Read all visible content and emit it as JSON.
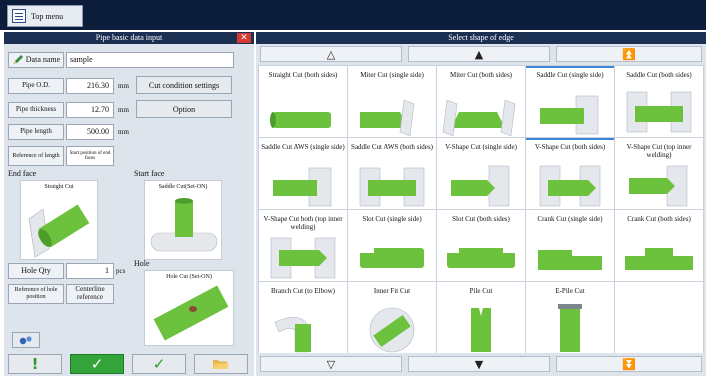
{
  "top_bar": {
    "top_menu_label": "Top menu"
  },
  "left_panel": {
    "title": "Pipe basic data input",
    "close_symbol": "✕",
    "data_name": {
      "label": "Data name",
      "value": "sample"
    },
    "pipe_od": {
      "label": "Pipe O.D.",
      "value": "216.30",
      "unit": "mm"
    },
    "pipe_thickness": {
      "label": "Pipe thickness",
      "value": "12.70",
      "unit": "mm"
    },
    "pipe_length": {
      "label": "Pipe length",
      "value": "500.00",
      "unit": "mm"
    },
    "reference_length": {
      "label": "Reference of length",
      "value": "Start position of end faces"
    },
    "cut_condition_label": "Cut condition settings",
    "option_label": "Option",
    "end_face": {
      "label": "End face",
      "preview_caption": "Straight Cut"
    },
    "start_face": {
      "label": "Start face",
      "preview_caption": "Saddle Cut(Set-ON)"
    },
    "hole_qty": {
      "label": "Hole Qty",
      "value": "1",
      "unit": "pcs"
    },
    "hole_ref": {
      "label": "Reference of hole position",
      "value": "Centerline reference"
    },
    "hole": {
      "label": "Hole",
      "preview_caption": "Hole Cut (Set-ON)"
    },
    "action_symbols": {
      "warning": "!",
      "confirm": "✓",
      "check": "✓"
    },
    "colors": {
      "confirm_button": "#35a43a",
      "header": "#1b2f52",
      "panel": "#dde4eb"
    }
  },
  "right_panel": {
    "title": "Select shape of edge",
    "nav_top": [
      "△",
      "▲",
      "⏫"
    ],
    "nav_bottom": [
      "▽",
      "▼",
      "⏬"
    ],
    "tiles": [
      {
        "label": "Straight Cut (both sides)",
        "selected": false
      },
      {
        "label": "Miter Cut (single side)",
        "selected": false
      },
      {
        "label": "Miter Cut (both sides)",
        "selected": false
      },
      {
        "label": "Saddle Cut (single side)",
        "selected": true
      },
      {
        "label": "Saddle Cut (both sides)",
        "selected": false
      },
      {
        "label": "Saddle Cut AWS (single side)",
        "selected": false
      },
      {
        "label": "Saddle Cut AWS (both sides)",
        "selected": false
      },
      {
        "label": "V-Shape Cut (single side)",
        "selected": false
      },
      {
        "label": "V-Shape Cut (both sides)",
        "selected": true
      },
      {
        "label": "V-Shape Cut (top inner welding)",
        "selected": false
      },
      {
        "label": "V-Shape Cut both (top inner welding)",
        "selected": false
      },
      {
        "label": "Slot Cut (single side)",
        "selected": false
      },
      {
        "label": "Slot Cut (both sides)",
        "selected": false
      },
      {
        "label": "Crank Cut (single side)",
        "selected": false
      },
      {
        "label": "Crank Cut (both sides)",
        "selected": false
      },
      {
        "label": "Branch Cut (to Elbow)",
        "selected": false
      },
      {
        "label": "Inner Fit Cut",
        "selected": false
      },
      {
        "label": "Pile Cut",
        "selected": false
      },
      {
        "label": "E-Pile Cut",
        "selected": false
      },
      {
        "label": "",
        "selected": false
      }
    ]
  }
}
